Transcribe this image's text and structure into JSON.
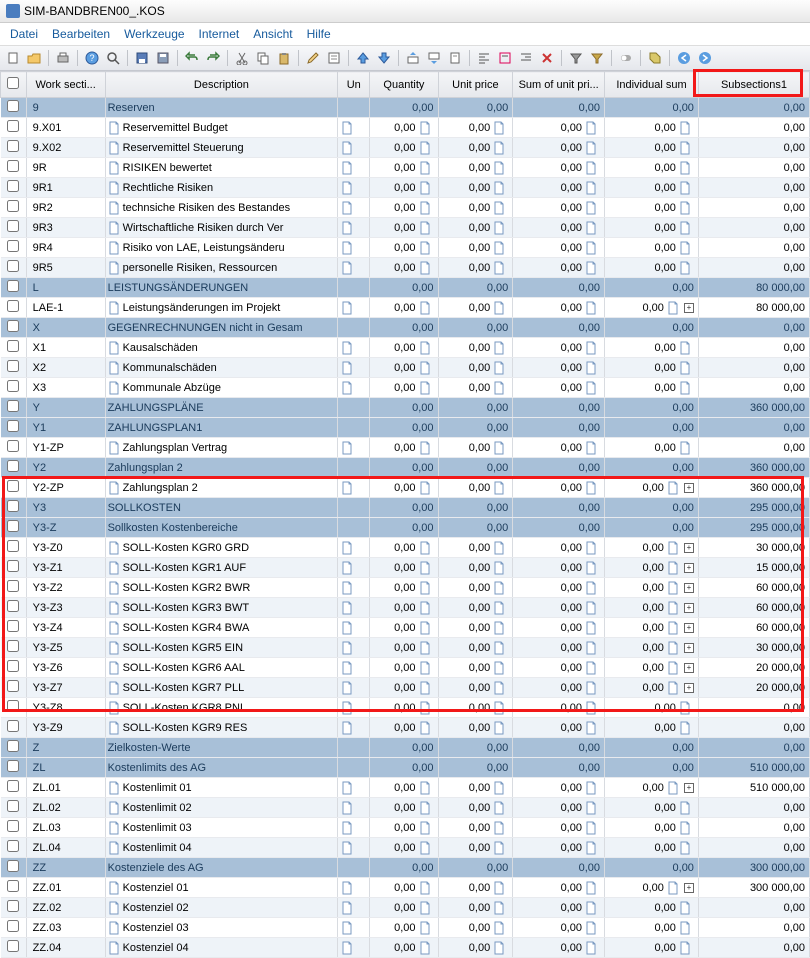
{
  "title": "SIM-BANDBREN00_.KOS",
  "menu": [
    "Datei",
    "Bearbeiten",
    "Werkzeuge",
    "Internet",
    "Ansicht",
    "Hilfe"
  ],
  "columns": {
    "chk": "",
    "code": "Work secti...",
    "desc": "Description",
    "un": "Un",
    "qty": "Quantity",
    "up": "Unit price",
    "sum": "Sum of unit pri...",
    "ind": "Individual sum",
    "sub": "Subsections1"
  },
  "rows": [
    {
      "g": 1,
      "code": "9",
      "desc": "Reserven",
      "qty": "0,00",
      "up": "0,00",
      "sum": "0,00",
      "ind": "0,00",
      "sub": "0,00"
    },
    {
      "code": "9.X01",
      "desc": "Reservemittel Budget",
      "qty": "0,00",
      "up": "0,00",
      "sum": "0,00",
      "ind": "0,00",
      "sub": "0,00",
      "leaf": 1
    },
    {
      "code": "9.X02",
      "desc": "Reservemittel Steuerung",
      "qty": "0,00",
      "up": "0,00",
      "sum": "0,00",
      "ind": "0,00",
      "sub": "0,00",
      "leaf": 1
    },
    {
      "code": "9R",
      "desc": "RISIKEN bewertet",
      "qty": "0,00",
      "up": "0,00",
      "sum": "0,00",
      "ind": "0,00",
      "sub": "0,00",
      "leaf": 1
    },
    {
      "code": "9R1",
      "desc": "Rechtliche Risiken",
      "qty": "0,00",
      "up": "0,00",
      "sum": "0,00",
      "ind": "0,00",
      "sub": "0,00",
      "leaf": 1
    },
    {
      "code": "9R2",
      "desc": "technsiche Risiken des Bestandes",
      "qty": "0,00",
      "up": "0,00",
      "sum": "0,00",
      "ind": "0,00",
      "sub": "0,00",
      "leaf": 1
    },
    {
      "code": "9R3",
      "desc": "Wirtschaftliche Risiken durch Ver",
      "qty": "0,00",
      "up": "0,00",
      "sum": "0,00",
      "ind": "0,00",
      "sub": "0,00",
      "leaf": 1
    },
    {
      "code": "9R4",
      "desc": "Risiko von LAE, Leistungsänderu",
      "qty": "0,00",
      "up": "0,00",
      "sum": "0,00",
      "ind": "0,00",
      "sub": "0,00",
      "leaf": 1
    },
    {
      "code": "9R5",
      "desc": "personelle Risiken, Ressourcen",
      "qty": "0,00",
      "up": "0,00",
      "sum": "0,00",
      "ind": "0,00",
      "sub": "0,00",
      "leaf": 1
    },
    {
      "g": 1,
      "code": "L",
      "desc": "LEISTUNGSÄNDERUNGEN",
      "qty": "0,00",
      "up": "0,00",
      "sum": "0,00",
      "ind": "0,00",
      "sub": "80 000,00"
    },
    {
      "code": "LAE-1",
      "desc": "Leistungsänderungen im Projekt",
      "qty": "0,00",
      "up": "0,00",
      "sum": "0,00",
      "ind": "0,00",
      "sub": "80 000,00",
      "leaf": 1,
      "plus": 1
    },
    {
      "g": 1,
      "code": "X",
      "desc": "GEGENRECHNUNGEN nicht in Gesam",
      "qty": "0,00",
      "up": "0,00",
      "sum": "0,00",
      "ind": "0,00",
      "sub": "0,00"
    },
    {
      "code": "X1",
      "desc": "Kausalschäden",
      "qty": "0,00",
      "up": "0,00",
      "sum": "0,00",
      "ind": "0,00",
      "sub": "0,00",
      "leaf": 1
    },
    {
      "code": "X2",
      "desc": "Kommunalschäden",
      "qty": "0,00",
      "up": "0,00",
      "sum": "0,00",
      "ind": "0,00",
      "sub": "0,00",
      "leaf": 1
    },
    {
      "code": "X3",
      "desc": "Kommunale Abzüge",
      "qty": "0,00",
      "up": "0,00",
      "sum": "0,00",
      "ind": "0,00",
      "sub": "0,00",
      "leaf": 1
    },
    {
      "g": 1,
      "code": "Y",
      "desc": "ZAHLUNGSPLÄNE",
      "qty": "0,00",
      "up": "0,00",
      "sum": "0,00",
      "ind": "0,00",
      "sub": "360 000,00"
    },
    {
      "g": 1,
      "code": "Y1",
      "desc": "ZAHLUNGSPLAN1",
      "qty": "0,00",
      "up": "0,00",
      "sum": "0,00",
      "ind": "0,00",
      "sub": "0,00"
    },
    {
      "code": "Y1-ZP",
      "desc": "Zahlungsplan Vertrag",
      "qty": "0,00",
      "up": "0,00",
      "sum": "0,00",
      "ind": "0,00",
      "sub": "0,00",
      "leaf": 1
    },
    {
      "g": 1,
      "code": "Y2",
      "desc": "Zahlungsplan 2",
      "qty": "0,00",
      "up": "0,00",
      "sum": "0,00",
      "ind": "0,00",
      "sub": "360 000,00"
    },
    {
      "code": "Y2-ZP",
      "desc": "Zahlungsplan 2",
      "qty": "0,00",
      "up": "0,00",
      "sum": "0,00",
      "ind": "0,00",
      "sub": "360 000,00",
      "leaf": 1,
      "plus": 1
    },
    {
      "g": 1,
      "code": "Y3",
      "desc": "SOLLKOSTEN",
      "qty": "0,00",
      "up": "0,00",
      "sum": "0,00",
      "ind": "0,00",
      "sub": "295 000,00"
    },
    {
      "g": 1,
      "code": "Y3-Z",
      "desc": "Sollkosten Kostenbereiche",
      "qty": "0,00",
      "up": "0,00",
      "sum": "0,00",
      "ind": "0,00",
      "sub": "295 000,00"
    },
    {
      "code": "Y3-Z0",
      "desc": "SOLL-Kosten KGR0 GRD",
      "qty": "0,00",
      "up": "0,00",
      "sum": "0,00",
      "ind": "0,00",
      "sub": "30 000,00",
      "leaf": 1,
      "plus": 1
    },
    {
      "code": "Y3-Z1",
      "desc": "SOLL-Kosten KGR1 AUF",
      "qty": "0,00",
      "up": "0,00",
      "sum": "0,00",
      "ind": "0,00",
      "sub": "15 000,00",
      "leaf": 1,
      "plus": 1
    },
    {
      "code": "Y3-Z2",
      "desc": "SOLL-Kosten KGR2 BWR",
      "qty": "0,00",
      "up": "0,00",
      "sum": "0,00",
      "ind": "0,00",
      "sub": "60 000,00",
      "leaf": 1,
      "plus": 1
    },
    {
      "code": "Y3-Z3",
      "desc": "SOLL-Kosten KGR3 BWT",
      "qty": "0,00",
      "up": "0,00",
      "sum": "0,00",
      "ind": "0,00",
      "sub": "60 000,00",
      "leaf": 1,
      "plus": 1
    },
    {
      "code": "Y3-Z4",
      "desc": "SOLL-Kosten KGR4 BWA",
      "qty": "0,00",
      "up": "0,00",
      "sum": "0,00",
      "ind": "0,00",
      "sub": "60 000,00",
      "leaf": 1,
      "plus": 1
    },
    {
      "code": "Y3-Z5",
      "desc": "SOLL-Kosten KGR5 EIN",
      "qty": "0,00",
      "up": "0,00",
      "sum": "0,00",
      "ind": "0,00",
      "sub": "30 000,00",
      "leaf": 1,
      "plus": 1
    },
    {
      "code": "Y3-Z6",
      "desc": "SOLL-Kosten KGR6 AAL",
      "qty": "0,00",
      "up": "0,00",
      "sum": "0,00",
      "ind": "0,00",
      "sub": "20 000,00",
      "leaf": 1,
      "plus": 1
    },
    {
      "code": "Y3-Z7",
      "desc": "SOLL-Kosten KGR7 PLL",
      "qty": "0,00",
      "up": "0,00",
      "sum": "0,00",
      "ind": "0,00",
      "sub": "20 000,00",
      "leaf": 1,
      "plus": 1
    },
    {
      "code": "Y3-Z8",
      "desc": "SOLL-Kosten KGR8 PNL",
      "qty": "0,00",
      "up": "0,00",
      "sum": "0,00",
      "ind": "0,00",
      "sub": "0,00",
      "leaf": 1
    },
    {
      "code": "Y3-Z9",
      "desc": "SOLL-Kosten KGR9 RES",
      "qty": "0,00",
      "up": "0,00",
      "sum": "0,00",
      "ind": "0,00",
      "sub": "0,00",
      "leaf": 1
    },
    {
      "g": 1,
      "code": "Z",
      "desc": "Zielkosten-Werte",
      "qty": "0,00",
      "up": "0,00",
      "sum": "0,00",
      "ind": "0,00",
      "sub": "0,00"
    },
    {
      "g": 1,
      "code": "ZL",
      "desc": "Kostenlimits des AG",
      "qty": "0,00",
      "up": "0,00",
      "sum": "0,00",
      "ind": "0,00",
      "sub": "510 000,00"
    },
    {
      "code": "ZL.01",
      "desc": "Kostenlimit 01",
      "qty": "0,00",
      "up": "0,00",
      "sum": "0,00",
      "ind": "0,00",
      "sub": "510 000,00",
      "leaf": 1,
      "plus": 1
    },
    {
      "code": "ZL.02",
      "desc": "Kostenlimit 02",
      "qty": "0,00",
      "up": "0,00",
      "sum": "0,00",
      "ind": "0,00",
      "sub": "0,00",
      "leaf": 1
    },
    {
      "code": "ZL.03",
      "desc": "Kostenlimit 03",
      "qty": "0,00",
      "up": "0,00",
      "sum": "0,00",
      "ind": "0,00",
      "sub": "0,00",
      "leaf": 1
    },
    {
      "code": "ZL.04",
      "desc": "Kostenlimit 04",
      "qty": "0,00",
      "up": "0,00",
      "sum": "0,00",
      "ind": "0,00",
      "sub": "0,00",
      "leaf": 1
    },
    {
      "g": 1,
      "code": "ZZ",
      "desc": "Kostenziele des AG",
      "qty": "0,00",
      "up": "0,00",
      "sum": "0,00",
      "ind": "0,00",
      "sub": "300 000,00"
    },
    {
      "code": "ZZ.01",
      "desc": "Kostenziel 01",
      "qty": "0,00",
      "up": "0,00",
      "sum": "0,00",
      "ind": "0,00",
      "sub": "300 000,00",
      "leaf": 1,
      "plus": 1
    },
    {
      "code": "ZZ.02",
      "desc": "Kostenziel 02",
      "qty": "0,00",
      "up": "0,00",
      "sum": "0,00",
      "ind": "0,00",
      "sub": "0,00",
      "leaf": 1
    },
    {
      "code": "ZZ.03",
      "desc": "Kostenziel 03",
      "qty": "0,00",
      "up": "0,00",
      "sum": "0,00",
      "ind": "0,00",
      "sub": "0,00",
      "leaf": 1
    },
    {
      "code": "ZZ.04",
      "desc": "Kostenziel 04",
      "qty": "0,00",
      "up": "0,00",
      "sum": "0,00",
      "ind": "0,00",
      "sub": "0,00",
      "leaf": 1
    }
  ],
  "toolbar_icons": [
    "new",
    "open",
    "sep",
    "print",
    "sep",
    "help",
    "search",
    "sep",
    "save",
    "disk",
    "sep",
    "undo",
    "redo",
    "sep",
    "cut",
    "copy",
    "paste",
    "sep",
    "edit",
    "props",
    "sep",
    "up",
    "down",
    "sep",
    "insert-above",
    "insert-below",
    "doc",
    "sep",
    "align-l",
    "align-c",
    "align-r",
    "delete",
    "sep",
    "filter",
    "filter2",
    "sep",
    "toggle",
    "sep",
    "tag",
    "sep",
    "back",
    "fwd"
  ]
}
